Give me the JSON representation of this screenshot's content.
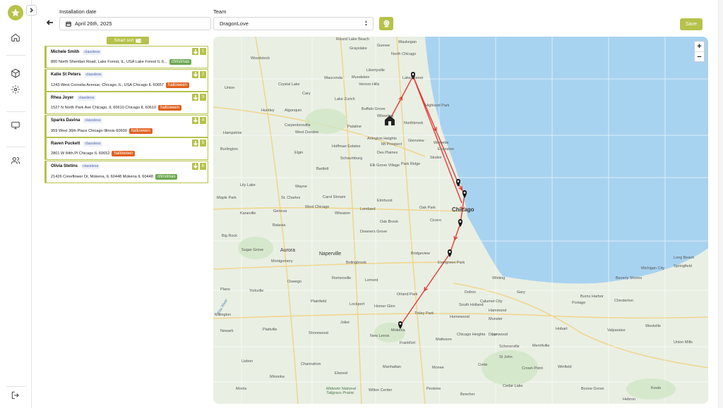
{
  "header": {
    "installation_date_label": "Installation date",
    "installation_date_value": "April 26th, 2025",
    "team_label": "Team",
    "team_value": "DragonLove",
    "save_label": "Save"
  },
  "smart_sort_label": "Smart sort",
  "stops": [
    {
      "name": "Michele Smith",
      "tag": "classless",
      "address": "800 North Sheridan Road, Lake Forest, IL, USA Lake Forest IL 6...",
      "badge": "christmas",
      "badge_color": "#6aa84f",
      "order": "1"
    },
    {
      "name": "Katie St Peters",
      "tag": "classless",
      "address": "1243 West Cornelia Avenue, Chicago, IL, USA Chicago IL 60657",
      "badge": "halloween",
      "badge_color": "#e0601f",
      "order": "2"
    },
    {
      "name": "Rhea Joyer",
      "tag": "classless",
      "address": "1527 N North Park Ave Chicago, IL 60610 Chicago IL 60610",
      "badge": "halloween",
      "badge_color": "#e0601f",
      "order": "3"
    },
    {
      "name": "Sparks Davina",
      "tag": "classless",
      "address": "959 West 36th Place Chicago Illinois 60609",
      "badge": "halloween",
      "badge_color": "#e0601f",
      "order": "4"
    },
    {
      "name": "Raven Puckett",
      "tag": "classless",
      "address": "2801 W 84th Pl Chicago IL 60652",
      "badge": "halloween",
      "badge_color": "#e0601f",
      "order": "5"
    },
    {
      "name": "Olivia Stetins",
      "tag": "classless",
      "address": "21426 Coneflower Dr, Mokena, IL 60448 Mokena IL 60448",
      "badge": "christmas",
      "badge_color": "#6aa84f",
      "order": "6"
    }
  ],
  "map": {
    "zoom_in": "+",
    "zoom_out": "−",
    "route_color": "#e53935",
    "lake_color": "#a8d3f0",
    "labels": [
      {
        "text": "Chicago",
        "cls": "big"
      },
      {
        "text": "Aurora",
        "cls": "mid"
      },
      {
        "text": "Naperville",
        "cls": "mid"
      },
      {
        "text": "Lake Forest",
        "cls": ""
      },
      {
        "text": "North Chicago",
        "cls": ""
      },
      {
        "text": "Waukegan",
        "cls": ""
      },
      {
        "text": "Highland Park",
        "cls": ""
      },
      {
        "text": "Northbrook",
        "cls": ""
      },
      {
        "text": "Wheeling",
        "cls": ""
      },
      {
        "text": "Buffalo Grove",
        "cls": ""
      },
      {
        "text": "Glenview",
        "cls": ""
      },
      {
        "text": "Wilmette",
        "cls": ""
      },
      {
        "text": "Evanston",
        "cls": ""
      },
      {
        "text": "Skokie",
        "cls": ""
      },
      {
        "text": "Des Plaines",
        "cls": ""
      },
      {
        "text": "Park Ridge",
        "cls": ""
      },
      {
        "text": "Schaumburg",
        "cls": ""
      },
      {
        "text": "Arlington Heights",
        "cls": ""
      },
      {
        "text": "Mt Prospect",
        "cls": ""
      },
      {
        "text": "Elk Grove Village",
        "cls": ""
      },
      {
        "text": "Palatine",
        "cls": ""
      },
      {
        "text": "Hoffman Estates",
        "cls": ""
      },
      {
        "text": "Elgin",
        "cls": ""
      },
      {
        "text": "Bartlett",
        "cls": ""
      },
      {
        "text": "Carol Stream",
        "cls": ""
      },
      {
        "text": "Wheaton",
        "cls": ""
      },
      {
        "text": "West Chicago",
        "cls": ""
      },
      {
        "text": "Lombard",
        "cls": ""
      },
      {
        "text": "Elmhurst",
        "cls": ""
      },
      {
        "text": "Oak Park",
        "cls": ""
      },
      {
        "text": "Cicero",
        "cls": ""
      },
      {
        "text": "Oak Brook",
        "cls": ""
      },
      {
        "text": "Downers Grove",
        "cls": ""
      },
      {
        "text": "Bolingbrook",
        "cls": ""
      },
      {
        "text": "Bridgeview",
        "cls": ""
      },
      {
        "text": "Evergreen Park",
        "cls": ""
      },
      {
        "text": "Orland Park",
        "cls": ""
      },
      {
        "text": "Tinley Park",
        "cls": ""
      },
      {
        "text": "Homer Glen",
        "cls": ""
      },
      {
        "text": "Mokena",
        "cls": ""
      },
      {
        "text": "Frankfort",
        "cls": ""
      },
      {
        "text": "New Lenox",
        "cls": ""
      },
      {
        "text": "Joliet",
        "cls": ""
      },
      {
        "text": "Plainfield",
        "cls": ""
      },
      {
        "text": "Romeoville",
        "cls": ""
      },
      {
        "text": "Lemont",
        "cls": ""
      },
      {
        "text": "Lockport",
        "cls": ""
      },
      {
        "text": "Matteson",
        "cls": ""
      },
      {
        "text": "Chicago Heights",
        "cls": ""
      },
      {
        "text": "Homewood",
        "cls": ""
      },
      {
        "text": "South Holland",
        "cls": ""
      },
      {
        "text": "Calumet City",
        "cls": ""
      },
      {
        "text": "Hammond",
        "cls": ""
      },
      {
        "text": "Munster",
        "cls": ""
      },
      {
        "text": "Whiting",
        "cls": ""
      },
      {
        "text": "Dolton",
        "cls": ""
      },
      {
        "text": "Gary",
        "cls": ""
      },
      {
        "text": "Hobart",
        "cls": ""
      },
      {
        "text": "Merrillville",
        "cls": ""
      },
      {
        "text": "Crown Point",
        "cls": ""
      },
      {
        "text": "St John",
        "cls": ""
      },
      {
        "text": "Schererville",
        "cls": ""
      },
      {
        "text": "Cedar Lake",
        "cls": ""
      },
      {
        "text": "Winfield",
        "cls": ""
      },
      {
        "text": "Valparaiso",
        "cls": ""
      },
      {
        "text": "Portage",
        "cls": ""
      },
      {
        "text": "Chesterton",
        "cls": ""
      },
      {
        "text": "Michigan City",
        "cls": ""
      },
      {
        "text": "Long Beach",
        "cls": ""
      },
      {
        "text": "Springfield",
        "cls": ""
      },
      {
        "text": "Beverly Shores",
        "cls": ""
      },
      {
        "text": "Burns Harbor",
        "cls": ""
      },
      {
        "text": "Westville",
        "cls": ""
      },
      {
        "text": "Union Mills",
        "cls": ""
      },
      {
        "text": "Kouts",
        "cls": ""
      },
      {
        "text": "Boone Grove",
        "cls": ""
      },
      {
        "text": "Hebron",
        "cls": ""
      },
      {
        "text": "Shorewood",
        "cls": ""
      },
      {
        "text": "Channahon",
        "cls": ""
      },
      {
        "text": "Minooka",
        "cls": ""
      },
      {
        "text": "Morris",
        "cls": ""
      },
      {
        "text": "Elwood",
        "cls": ""
      },
      {
        "text": "Manhattan",
        "cls": ""
      },
      {
        "text": "Wilton Center",
        "cls": ""
      },
      {
        "text": "Peotone",
        "cls": ""
      },
      {
        "text": "Monee",
        "cls": ""
      },
      {
        "text": "Beecher",
        "cls": ""
      },
      {
        "text": "Crete",
        "cls": ""
      },
      {
        "text": "Lynwood",
        "cls": ""
      },
      {
        "text": "Dyer",
        "cls": ""
      },
      {
        "text": "Oswego",
        "cls": ""
      },
      {
        "text": "Yorkville",
        "cls": ""
      },
      {
        "text": "Plano",
        "cls": ""
      },
      {
        "text": "Montgomery",
        "cls": ""
      },
      {
        "text": "Sugar Grove",
        "cls": ""
      },
      {
        "text": "Batavia",
        "cls": ""
      },
      {
        "text": "Geneva",
        "cls": ""
      },
      {
        "text": "St. Charles",
        "cls": ""
      },
      {
        "text": "Wayne",
        "cls": ""
      },
      {
        "text": "Hampshire",
        "cls": ""
      },
      {
        "text": "Huntley",
        "cls": ""
      },
      {
        "text": "Algonquin",
        "cls": ""
      },
      {
        "text": "Crystal Lake",
        "cls": ""
      },
      {
        "text": "Carpentersville",
        "cls": ""
      },
      {
        "text": "West Dundee",
        "cls": ""
      },
      {
        "text": "Cary",
        "cls": ""
      },
      {
        "text": "Lake Zurich",
        "cls": ""
      },
      {
        "text": "Mundelein",
        "cls": ""
      },
      {
        "text": "Libertyville",
        "cls": ""
      },
      {
        "text": "Vernon Hills",
        "cls": ""
      },
      {
        "text": "Grayslake",
        "cls": ""
      },
      {
        "text": "Round Lake Beach",
        "cls": ""
      },
      {
        "text": "Gurnee",
        "cls": ""
      },
      {
        "text": "Wauconda",
        "cls": ""
      },
      {
        "text": "Woodstock",
        "cls": ""
      },
      {
        "text": "Union",
        "cls": ""
      },
      {
        "text": "Burlington",
        "cls": ""
      },
      {
        "text": "Lily Lake",
        "cls": ""
      },
      {
        "text": "Maple Park",
        "cls": ""
      },
      {
        "text": "Kaneville",
        "cls": ""
      },
      {
        "text": "Big Rock",
        "cls": ""
      },
      {
        "text": "Newark",
        "cls": ""
      },
      {
        "text": "Millington",
        "cls": ""
      },
      {
        "text": "Plattville",
        "cls": ""
      },
      {
        "text": "Lisbon",
        "cls": ""
      },
      {
        "text": "Midewin National Tallgrass Prairie",
        "cls": ""
      },
      {
        "text": "Fox River",
        "cls": ""
      }
    ]
  }
}
